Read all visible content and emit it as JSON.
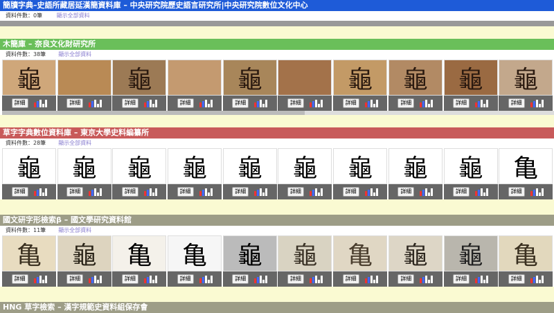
{
  "top": {
    "title": "簡牘字典–史語所藏居延漢簡資料庫 – 中央研究院歷史語言研究所|中央研究院數位文化中心",
    "color": "#1e5bd8",
    "count": "資料件數：0筆",
    "show_all": "顯示全部資料"
  },
  "sections": [
    {
      "title": "木簡庫 – 奈良文化財研究所",
      "color": "#6abf5a",
      "count": "資料件數：38筆",
      "show_all": "顯示全部資料",
      "details_label": "詳細",
      "images": [
        {
          "glyph": "龜",
          "bg": "#cfa77a",
          "fg": "#2b1a10"
        },
        {
          "glyph": "",
          "bg": "#b98a55",
          "fg": "#2b1a10"
        },
        {
          "glyph": "龜",
          "bg": "#9c7a55",
          "fg": "#2b1a10"
        },
        {
          "glyph": "",
          "bg": "#c49a70",
          "fg": "#2b1a10"
        },
        {
          "glyph": "龜",
          "bg": "#a8865a",
          "fg": "#2b1a10"
        },
        {
          "glyph": "",
          "bg": "#a3724a",
          "fg": "#2b1a10"
        },
        {
          "glyph": "龜",
          "bg": "#c39a66",
          "fg": "#2b1a10"
        },
        {
          "glyph": "龜",
          "bg": "#b28a64",
          "fg": "#2b1a10"
        },
        {
          "glyph": "龜",
          "bg": "#9a6a42",
          "fg": "#2b1a10"
        },
        {
          "glyph": "龜",
          "bg": "#c3a88c",
          "fg": "#2b1a10"
        }
      ]
    },
    {
      "title": "草字字典數位資料庫 – 東京大學史料編纂所",
      "color": "#c85a5a",
      "count": "資料件數：28筆",
      "show_all": "顯示全部資料",
      "details_label": "詳細",
      "images": [
        {
          "glyph": "龜",
          "bg": "#ffffff",
          "fg": "#000000"
        },
        {
          "glyph": "龜",
          "bg": "#ffffff",
          "fg": "#000000"
        },
        {
          "glyph": "龜",
          "bg": "#ffffff",
          "fg": "#000000"
        },
        {
          "glyph": "龜",
          "bg": "#ffffff",
          "fg": "#000000"
        },
        {
          "glyph": "龜",
          "bg": "#ffffff",
          "fg": "#000000"
        },
        {
          "glyph": "龜",
          "bg": "#ffffff",
          "fg": "#000000"
        },
        {
          "glyph": "龜",
          "bg": "#ffffff",
          "fg": "#000000"
        },
        {
          "glyph": "龜",
          "bg": "#ffffff",
          "fg": "#000000"
        },
        {
          "glyph": "龜",
          "bg": "#ffffff",
          "fg": "#000000"
        },
        {
          "glyph": "亀",
          "bg": "#ffffff",
          "fg": "#000000"
        }
      ]
    },
    {
      "title": "國文研字形檢索β – 國文學研究資料館",
      "color": "#9d9d87",
      "count": "資料件數：11筆",
      "show_all": "顯示全部資料",
      "details_label": "詳細",
      "images": [
        {
          "glyph": "亀",
          "bg": "#e8dcc0",
          "fg": "#3a3020"
        },
        {
          "glyph": "龜",
          "bg": "#ddd4bf",
          "fg": "#2a2418"
        },
        {
          "glyph": "亀",
          "bg": "#f4f1ea",
          "fg": "#000000"
        },
        {
          "glyph": "亀",
          "bg": "#f6f6f6",
          "fg": "#000000"
        },
        {
          "glyph": "龜",
          "bg": "#bbbbbb",
          "fg": "#000000"
        },
        {
          "glyph": "龜",
          "bg": "#d9d3c2",
          "fg": "#3a3226"
        },
        {
          "glyph": "亀",
          "bg": "#e0d7c4",
          "fg": "#4a3e2e"
        },
        {
          "glyph": "龜",
          "bg": "#ddd6c6",
          "fg": "#2e2820"
        },
        {
          "glyph": "龜",
          "bg": "#b9b6ad",
          "fg": "#222222"
        },
        {
          "glyph": "亀",
          "bg": "#e2d8bd",
          "fg": "#3a3020"
        }
      ]
    }
  ],
  "bottom": {
    "title": "HNG 草字檢索 – 漢字規範史資料組保存會",
    "color": "#9d9d87"
  }
}
